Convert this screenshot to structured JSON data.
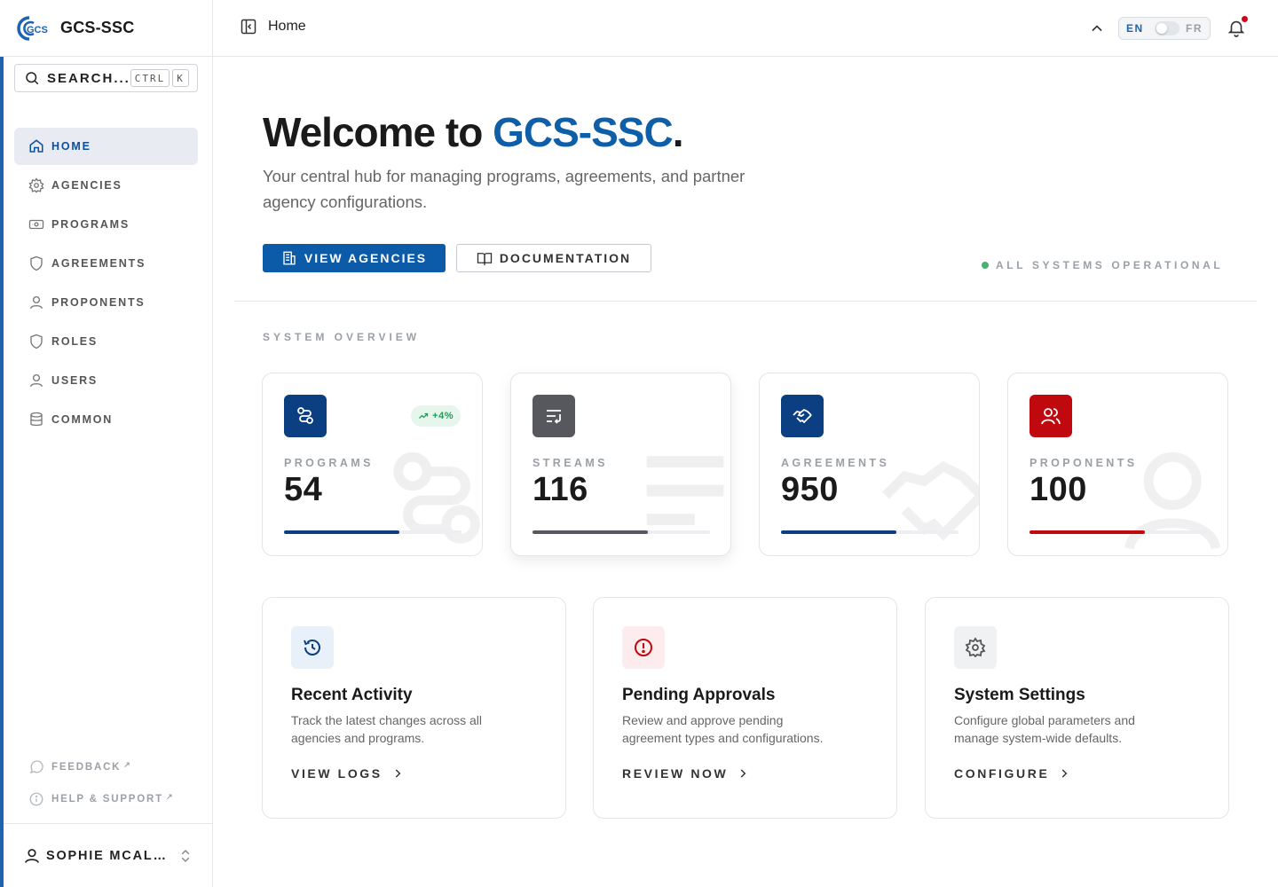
{
  "app": {
    "name": "GCS-SSC",
    "logo_text": "GCS"
  },
  "search": {
    "label": "SEARCH...",
    "kbd_ctrl": "CTRL",
    "kbd_k": "K"
  },
  "sidebar": {
    "items": [
      {
        "label": "HOME",
        "icon": "home-icon",
        "active": true
      },
      {
        "label": "AGENCIES",
        "icon": "gear-icon"
      },
      {
        "label": "PROGRAMS",
        "icon": "banknote-icon"
      },
      {
        "label": "AGREEMENTS",
        "icon": "shield-icon"
      },
      {
        "label": "PROPONENTS",
        "icon": "user-icon"
      },
      {
        "label": "ROLES",
        "icon": "shield-icon"
      },
      {
        "label": "USERS",
        "icon": "user-icon"
      },
      {
        "label": "COMMON",
        "icon": "database-icon"
      }
    ],
    "feedback": "FEEDBACK",
    "help": "HELP & SUPPORT",
    "user": "SOPHIE MCALLISTER"
  },
  "topbar": {
    "page_title": "Home",
    "lang_en": "EN",
    "lang_fr": "FR"
  },
  "hero": {
    "title_prefix": "Welcome to ",
    "title_brand": "GCS-SSC",
    "title_suffix": ".",
    "subtitle": "Your central hub for managing programs, agreements, and partner agency configurations.",
    "primary_button": "VIEW AGENCIES",
    "secondary_button": "DOCUMENTATION",
    "status": "ALL SYSTEMS OPERATIONAL"
  },
  "overview": {
    "section_label": "SYSTEM OVERVIEW",
    "stats": [
      {
        "label": "PROGRAMS",
        "value": "54",
        "badge": "+4%",
        "color": "#0b3f82",
        "progress": 0.65
      },
      {
        "label": "STREAMS",
        "value": "116",
        "color": "#56585d",
        "progress": 0.65
      },
      {
        "label": "AGREEMENTS",
        "value": "950",
        "color": "#0b3f82",
        "progress": 0.65
      },
      {
        "label": "PROPONENTS",
        "value": "100",
        "color": "#c0080f",
        "progress": 0.65
      }
    ]
  },
  "cards": [
    {
      "title": "Recent Activity",
      "desc": "Track the latest changes across all agencies and programs.",
      "link": "VIEW LOGS"
    },
    {
      "title": "Pending Approvals",
      "desc": "Review and approve pending agreement types and configurations.",
      "link": "REVIEW NOW"
    },
    {
      "title": "System Settings",
      "desc": "Configure global parameters and manage system-wide defaults.",
      "link": "CONFIGURE"
    }
  ],
  "colors": {
    "accent": "#0b5ba8",
    "brand_blue": "#0f5ea8",
    "status_green": "#4caf72",
    "alert_red": "#c0080f",
    "notification_dot": "#d0021b"
  }
}
